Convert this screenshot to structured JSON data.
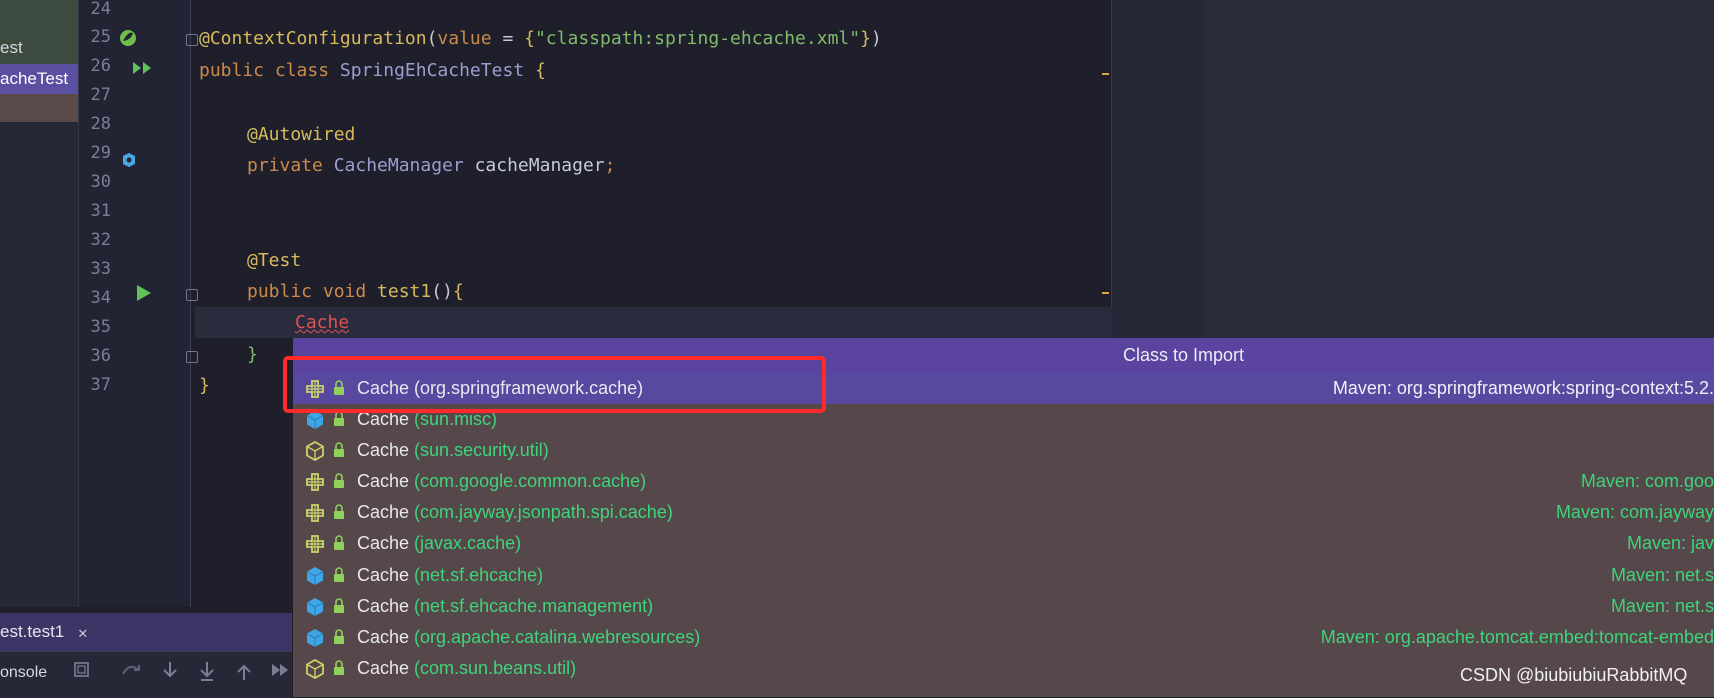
{
  "project_tree": {
    "items": [
      "est",
      "acheTest",
      ""
    ]
  },
  "gutter": {
    "line_numbers": [
      "24",
      "25",
      "26",
      "27",
      "28",
      "29",
      "30",
      "31",
      "32",
      "33",
      "34",
      "35",
      "36",
      "37"
    ]
  },
  "editor": {
    "lines": {
      "l25": {
        "ann": "@ContextConfiguration",
        "p1": "(",
        "kw": "value",
        "p2": " = ",
        "b1": "{",
        "str": "\"classpath:spring-ehcache.xml\"",
        "b2": "}",
        "p3": ")"
      },
      "l26": {
        "kw": "public class ",
        "cls": "SpringEhCacheTest",
        "p1": " ",
        "b1": "{"
      },
      "l28": {
        "ann": "@Autowired"
      },
      "l29": {
        "kw": "private ",
        "cls": "CacheManager",
        "p1": " cacheManager",
        "kw2": ";"
      },
      "l32": {
        "ann": "@Test"
      },
      "l33": {
        "kw": "public void ",
        "fn": "test1",
        "p1": "()",
        "b1": "{"
      },
      "l34": {
        "err": "Cache"
      },
      "l35": {
        "b1": "}"
      },
      "l36": {
        "b1": "}"
      }
    }
  },
  "run_panel": {
    "tab_label": "est.test1",
    "close": "✕",
    "console_label": "onsole"
  },
  "import_popup": {
    "title": "Class to Import",
    "rows": [
      {
        "name": "Cache",
        "pkg": "(org.springframework.cache)",
        "source": "Maven: org.springframework:spring-context:5.2.",
        "icon": "interface-icon",
        "selected": true
      },
      {
        "name": "Cache",
        "pkg": "(sun.misc)",
        "source": "",
        "icon": "class-icon"
      },
      {
        "name": "Cache",
        "pkg": "(sun.security.util)",
        "source": "",
        "icon": "abstract-class-icon"
      },
      {
        "name": "Cache",
        "pkg": "(com.google.common.cache)",
        "source": "Maven: com.goo",
        "icon": "interface-icon"
      },
      {
        "name": "Cache",
        "pkg": "(com.jayway.jsonpath.spi.cache)",
        "source": "Maven: com.jayway",
        "icon": "interface-icon"
      },
      {
        "name": "Cache",
        "pkg": "(javax.cache)",
        "source": "Maven: jav",
        "icon": "interface-icon"
      },
      {
        "name": "Cache",
        "pkg": "(net.sf.ehcache)",
        "source": "Maven: net.s",
        "icon": "class-icon"
      },
      {
        "name": "Cache",
        "pkg": "(net.sf.ehcache.management)",
        "source": "Maven: net.s",
        "icon": "class-icon"
      },
      {
        "name": "Cache",
        "pkg": "(org.apache.catalina.webresources)",
        "source": "Maven: org.apache.tomcat.embed:tomcat-embed",
        "icon": "class-icon"
      },
      {
        "name": "Cache",
        "pkg": "(com.sun.beans.util)",
        "source": "",
        "icon": "abstract-class-icon"
      }
    ]
  },
  "watermark": "CSDN @biubiubiuRabbitMQ",
  "colors": {
    "popup_bg": "#56484a",
    "popup_header": "#5a44a0",
    "selected_row": "#5848a0",
    "package_green": "#3ed47a",
    "highlight_red": "#ff2b2b"
  }
}
